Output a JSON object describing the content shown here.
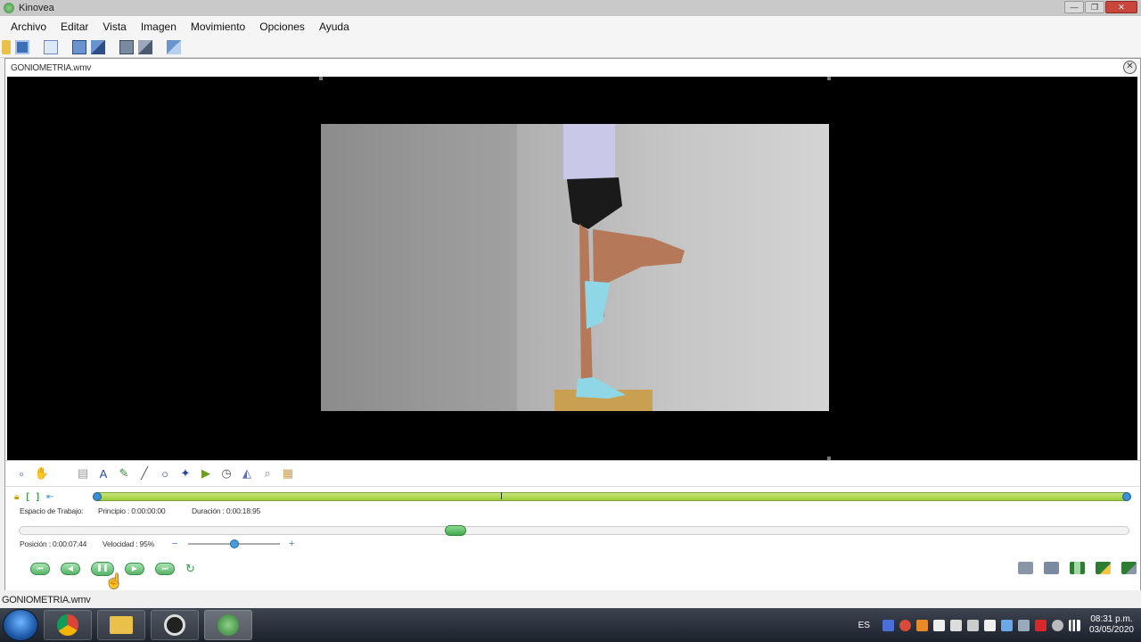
{
  "window": {
    "title": "Kinovea",
    "controls": [
      "—",
      "❐",
      "✕"
    ]
  },
  "menu": [
    "Archivo",
    "Editar",
    "Vista",
    "Imagen",
    "Movimiento",
    "Opciones",
    "Ayuda"
  ],
  "screen": {
    "file_name": "GONIOMETRIA.wmv",
    "close_label": "✕"
  },
  "workspace": {
    "label": "Espacio de Trabajo:",
    "start": "Principio : 0:00:00:00",
    "duration": "Duración : 0:00:18:95"
  },
  "playback": {
    "position": "Posición : 0:00:07:44",
    "speed": "Velocidad : 95%",
    "speed_fraction": 0.5,
    "position_fraction": 0.39,
    "minus": "−",
    "plus": "+"
  },
  "status_bar": "GONIOMETRIA.wmv",
  "taskbar": {
    "language": "ES",
    "time": "08:31 p.m.",
    "date": "03/05/2020"
  },
  "colors": {
    "timeline": "#9ccb3a",
    "play_buttons": "#57b468",
    "accent_blue": "#3c8fd6"
  }
}
